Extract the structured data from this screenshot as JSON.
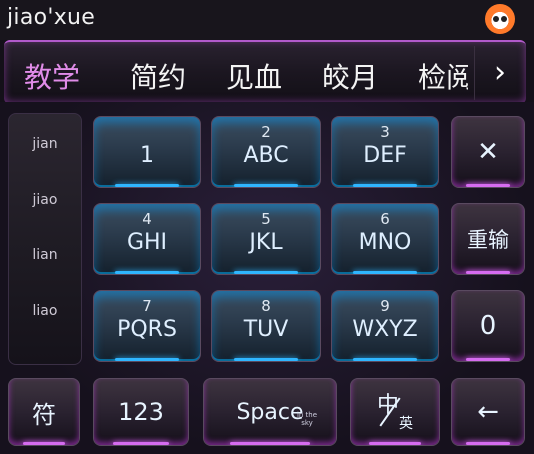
{
  "composition": {
    "text": "jiao'xue"
  },
  "candidates": [
    "教学",
    "简约",
    "见血",
    "皎月",
    "检阅"
  ],
  "pinyin_options": [
    "jian",
    "jiao",
    "lian",
    "liao"
  ],
  "keys": {
    "k1": {
      "num": "",
      "label": "1"
    },
    "k2": {
      "num": "2",
      "label": "ABC"
    },
    "k3": {
      "num": "3",
      "label": "DEF"
    },
    "k4": {
      "num": "4",
      "label": "GHI"
    },
    "k5": {
      "num": "5",
      "label": "JKL"
    },
    "k6": {
      "num": "6",
      "label": "MNO"
    },
    "k7": {
      "num": "7",
      "label": "PQRS"
    },
    "k8": {
      "num": "8",
      "label": "TUV"
    },
    "k9": {
      "num": "9",
      "label": "WXYZ"
    },
    "delete": "✕",
    "reinput": "重输",
    "zero": "0",
    "symbol": "符",
    "num123": "123",
    "space": "Space",
    "space_sub": "in the sky",
    "lang_top": "中",
    "lang_bottom": "英",
    "enter": "←"
  },
  "more_arrow": "›",
  "icons": {
    "app_logo": "fox-logo-icon",
    "more": "chevron-right-icon"
  },
  "colors": {
    "accent_blue": "#2fb6ff",
    "accent_purple": "#d66cf0",
    "first_candidate": "#e08ce8"
  }
}
